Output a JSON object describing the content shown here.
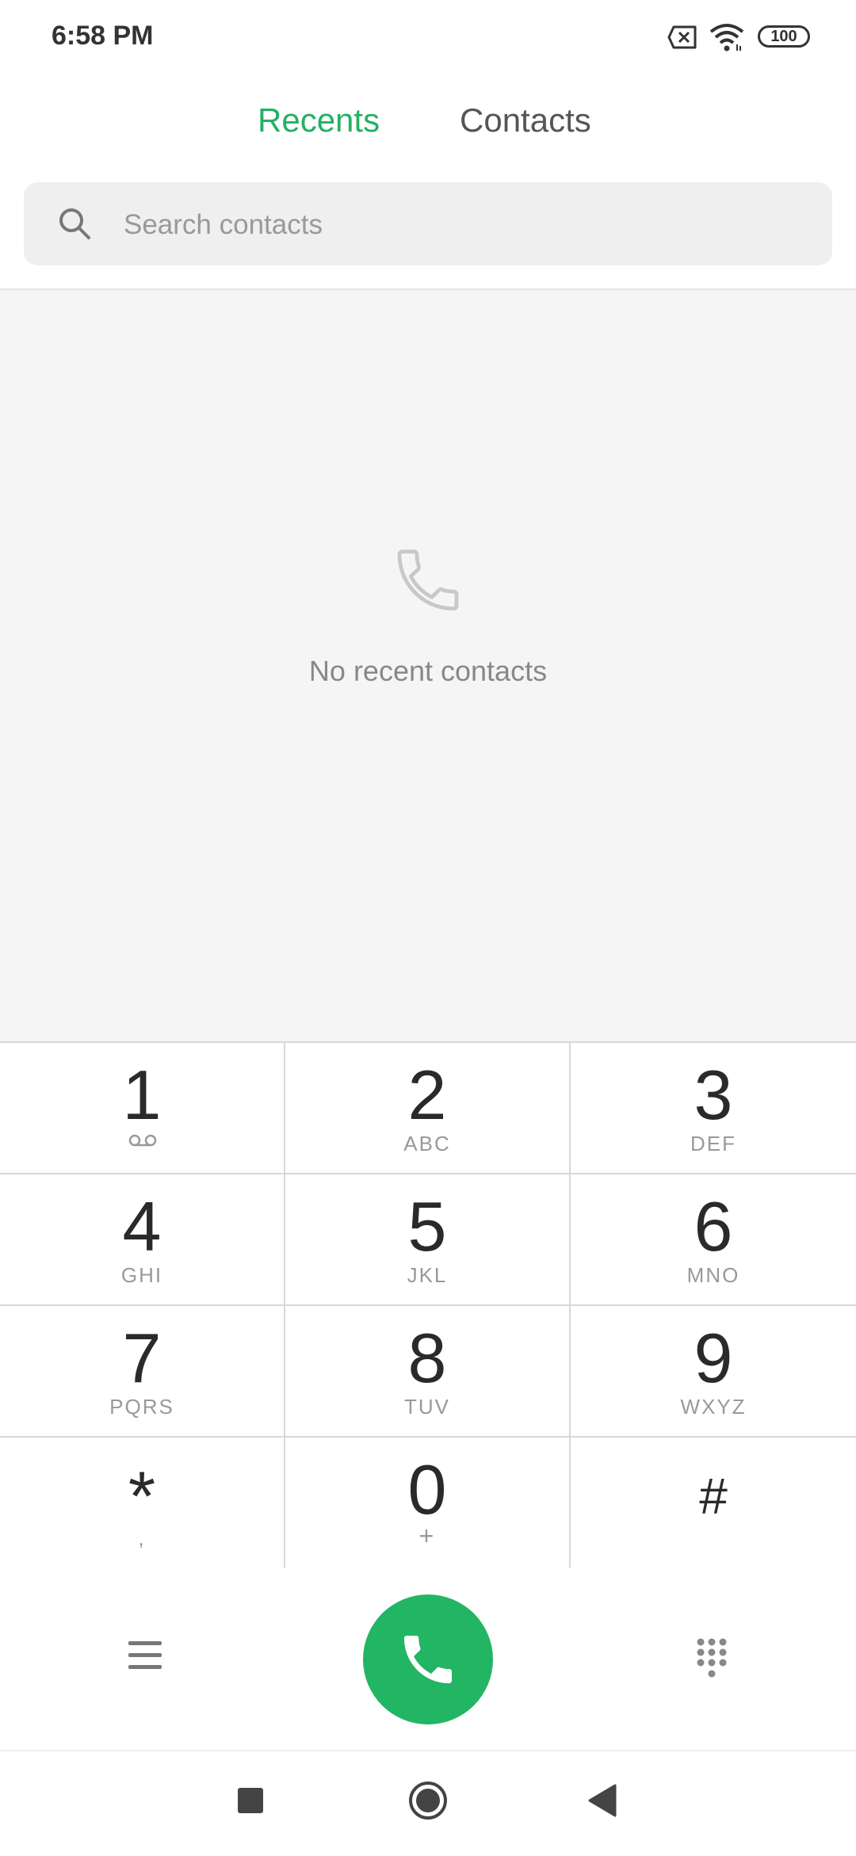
{
  "status_bar": {
    "time": "6:58 PM",
    "battery": "100",
    "icons": [
      "sim-error-icon",
      "wifi-icon",
      "battery-icon"
    ]
  },
  "tabs": [
    {
      "label": "Recents",
      "active": true
    },
    {
      "label": "Contacts",
      "active": false
    }
  ],
  "search": {
    "placeholder": "Search contacts",
    "value": ""
  },
  "recents": {
    "empty_message": "No recent contacts",
    "icon": "phone-outline-icon"
  },
  "keypad": {
    "keys": [
      {
        "digit": "1",
        "letters": "",
        "icon": "voicemail-icon"
      },
      {
        "digit": "2",
        "letters": "ABC"
      },
      {
        "digit": "3",
        "letters": "DEF"
      },
      {
        "digit": "4",
        "letters": "GHI"
      },
      {
        "digit": "5",
        "letters": "JKL"
      },
      {
        "digit": "6",
        "letters": "MNO"
      },
      {
        "digit": "7",
        "letters": "PQRS"
      },
      {
        "digit": "8",
        "letters": "TUV"
      },
      {
        "digit": "9",
        "letters": "WXYZ"
      },
      {
        "digit": "*",
        "letters": ","
      },
      {
        "digit": "0",
        "letters": "+"
      },
      {
        "digit": "#",
        "letters": ""
      }
    ]
  },
  "actions": {
    "menu_icon": "menu-icon",
    "call_icon": "phone-icon",
    "dialpad_icon": "dialpad-icon"
  },
  "colors": {
    "accent": "#22b163",
    "call_button": "#22b563",
    "empty_background": "#f5f5f5"
  }
}
